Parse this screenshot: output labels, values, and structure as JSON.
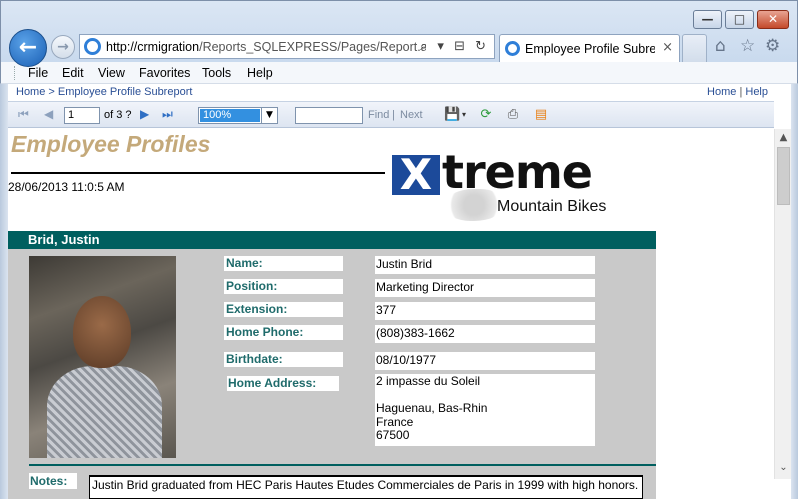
{
  "browser": {
    "address_domain": "http://crmigration",
    "address_path": "/Reports_SQLEXPRESS/Pages/Report.aspx?",
    "address_icons": "⌕ ▾ ⊟ ↻",
    "tab_title": "Employee Profile Subre...",
    "tab_close": "×",
    "back_glyph": "←",
    "forward_glyph": "→",
    "home_glyph": "⌂",
    "favorites_glyph": "☆",
    "tools_glyph": "⚙",
    "min_glyph": "—",
    "max_glyph": "□",
    "close_glyph": "✕"
  },
  "menu": [
    "File",
    "Edit",
    "View",
    "Favorites",
    "Tools",
    "Help"
  ],
  "breadcrumb": {
    "home": "Home",
    "separator": ">",
    "current": "Employee Profile Subreport",
    "right_home": "Home",
    "right_sep": "|",
    "right_help": "Help"
  },
  "toolbar": {
    "first_glyph": "⏮",
    "prev_glyph": "◀",
    "next_glyph": "▶",
    "last_glyph": "⏭",
    "page_value": "1",
    "of_text": "of 3 ?",
    "zoom_value": "100%",
    "zoom_arrow": "▼",
    "find_value": "",
    "find_label": "Find",
    "find_sep": "|",
    "next_label": "Next",
    "export_glyph": "💾",
    "export_arrow": "▾",
    "refresh_glyph": "⟳",
    "print_glyph": "⎙",
    "atom_glyph": "▤"
  },
  "report": {
    "title": "Employee Profiles",
    "date": "28/06/2013  11:0:5 AM",
    "logo": {
      "x_letter": "X",
      "treme": "treme",
      "sub": "Mountain Bikes"
    },
    "employee": {
      "header_name": "Brid, Justin",
      "fields": [
        {
          "label": "Name:",
          "value": "Justin Brid"
        },
        {
          "label": "Position:",
          "value": "Marketing Director"
        },
        {
          "label": "Extension:",
          "value": "377"
        },
        {
          "label": "Home Phone:",
          "value": "(808)383-1662"
        },
        {
          "label": "Birthdate:",
          "value": "08/10/1977"
        }
      ],
      "address_label": "Home Address:",
      "address_value": "2 impasse du Soleil\n\nHaguenau, Bas-Rhin\nFrance\n67500",
      "notes_label": "Notes:",
      "notes_value": "Justin Brid graduated from HEC Paris Hautes Etudes Commerciales de Paris in 1999 with high honors."
    }
  },
  "scrollbar": {
    "up_glyph": "▲",
    "down_glyph": "⌄"
  }
}
